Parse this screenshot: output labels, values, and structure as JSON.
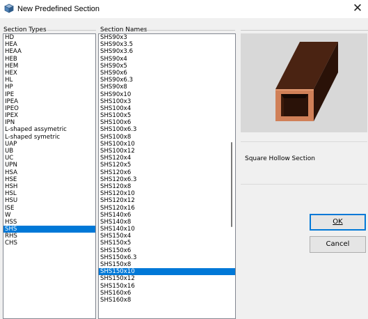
{
  "window": {
    "title": "New Predefined Section"
  },
  "section_types": {
    "label": "Section Types",
    "items": [
      "HD",
      "HEA",
      "HEAA",
      "HEB",
      "HEM",
      "HEX",
      "HL",
      "HP",
      "IPE",
      "IPEA",
      "IPEO",
      "IPEX",
      "IPN",
      "L-shaped assymetric",
      "L-shaped symetric",
      "UAP",
      "UB",
      "UC",
      "UPN",
      "HSA",
      "HSE",
      "HSH",
      "HSL",
      "HSU",
      "ISE",
      "W",
      "HSS",
      "SHS",
      "RHS",
      "CHS"
    ],
    "selected_index": 27
  },
  "section_names": {
    "label": "Section Names",
    "items": [
      "SHS90x3",
      "SHS90x3.5",
      "SHS90x3.6",
      "SHS90x4",
      "SHS90x5",
      "SHS90x6",
      "SHS90x6.3",
      "SHS90x8",
      "SHS90x10",
      "SHS100x3",
      "SHS100x4",
      "SHS100x5",
      "SHS100x6",
      "SHS100x6.3",
      "SHS100x8",
      "SHS100x10",
      "SHS100x12",
      "SHS120x4",
      "SHS120x5",
      "SHS120x6",
      "SHS120x6.3",
      "SHS120x8",
      "SHS120x10",
      "SHS120x12",
      "SHS120x16",
      "SHS140x6",
      "SHS140x8",
      "SHS140x10",
      "SHS150x4",
      "SHS150x5",
      "SHS150x6",
      "SHS150x6.3",
      "SHS150x8",
      "SHS150x10",
      "SHS150x12",
      "SHS150x16",
      "SHS160x6",
      "SHS160x8"
    ],
    "selected_index": 33,
    "scroll_position": 0.45
  },
  "preview": {
    "icon": "square-hollow-section-3d-icon",
    "tube_color": "#3a1a0c",
    "face_color": "#d08058"
  },
  "description": "Square Hollow Section",
  "buttons": {
    "ok": "OK",
    "cancel": "Cancel"
  },
  "colors": {
    "selection": "#0078d7",
    "default_button_border": "#0078d7"
  }
}
